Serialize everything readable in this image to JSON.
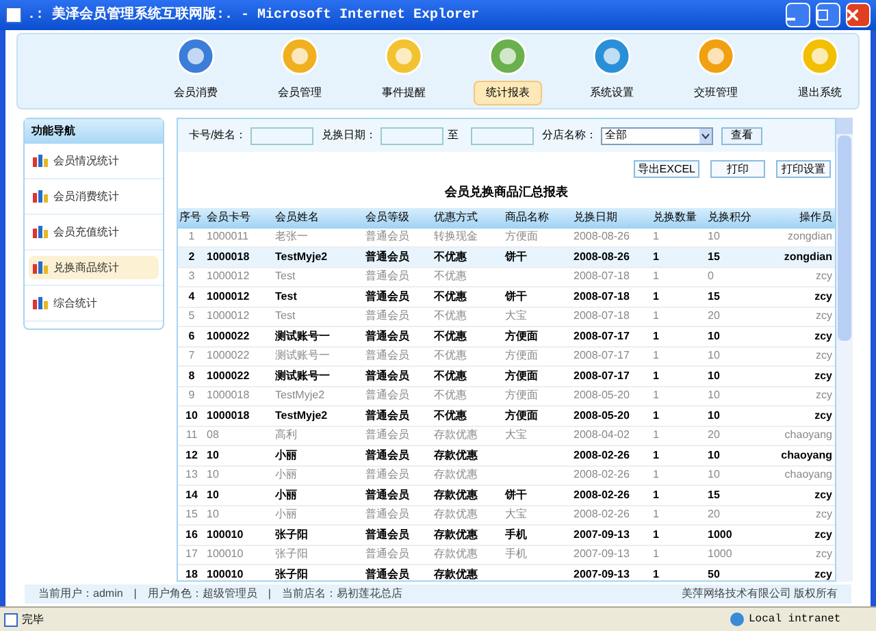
{
  "window": {
    "title": ".: 美泽会员管理系统互联网版:. - Microsoft Internet Explorer"
  },
  "nav": [
    {
      "label": "会员消费",
      "selected": false
    },
    {
      "label": "会员管理",
      "selected": false
    },
    {
      "label": "事件提醒",
      "selected": false
    },
    {
      "label": "统计报表",
      "selected": true
    },
    {
      "label": "系统设置",
      "selected": false
    },
    {
      "label": "交班管理",
      "selected": false
    },
    {
      "label": "退出系统",
      "selected": false
    }
  ],
  "sidebar": {
    "title": "功能导航",
    "items": [
      {
        "label": "会员情况统计",
        "selected": false
      },
      {
        "label": "会员消费统计",
        "selected": false
      },
      {
        "label": "会员充值统计",
        "selected": false
      },
      {
        "label": "兑换商品统计",
        "selected": true
      },
      {
        "label": "综合统计",
        "selected": false
      }
    ]
  },
  "filters": {
    "card_label": "卡号/姓名：",
    "date_label": "兑换日期：",
    "to_label": "至",
    "store_label": "分店名称：",
    "store_value": "全部",
    "search_button": "查看"
  },
  "actions": [
    "导出EXCEL",
    "打印",
    "打印设置"
  ],
  "report_title": "会员兑换商品汇总报表",
  "table": {
    "columns": [
      "序号",
      "会员卡号",
      "会员姓名",
      "会员等级",
      "优惠方式",
      "商品名称",
      "兑换日期",
      "兑换数量",
      "兑换积分",
      "操作员"
    ],
    "rows": [
      {
        "bold": false,
        "selected": false,
        "cells": [
          "1",
          "1000011",
          "老张一",
          "普通会员",
          "转换现金",
          "方便面",
          "2008-08-26",
          "1",
          "10",
          "zongdian"
        ]
      },
      {
        "bold": true,
        "selected": true,
        "cells": [
          "2",
          "1000018",
          "TestMyje2",
          "普通会员",
          "不优惠",
          "饼干",
          "2008-08-26",
          "1",
          "15",
          "zongdian"
        ]
      },
      {
        "bold": false,
        "selected": false,
        "cells": [
          "3",
          "1000012",
          "Test",
          "普通会员",
          "不优惠",
          "",
          "2008-07-18",
          "1",
          "0",
          "zcy"
        ]
      },
      {
        "bold": true,
        "selected": false,
        "cells": [
          "4",
          "1000012",
          "Test",
          "普通会员",
          "不优惠",
          "饼干",
          "2008-07-18",
          "1",
          "15",
          "zcy"
        ]
      },
      {
        "bold": false,
        "selected": false,
        "cells": [
          "5",
          "1000012",
          "Test",
          "普通会员",
          "不优惠",
          "大宝",
          "2008-07-18",
          "1",
          "20",
          "zcy"
        ]
      },
      {
        "bold": true,
        "selected": false,
        "cells": [
          "6",
          "1000022",
          "测试账号一",
          "普通会员",
          "不优惠",
          "方便面",
          "2008-07-17",
          "1",
          "10",
          "zcy"
        ]
      },
      {
        "bold": false,
        "selected": false,
        "cells": [
          "7",
          "1000022",
          "测试账号一",
          "普通会员",
          "不优惠",
          "方便面",
          "2008-07-17",
          "1",
          "10",
          "zcy"
        ]
      },
      {
        "bold": true,
        "selected": false,
        "cells": [
          "8",
          "1000022",
          "测试账号一",
          "普通会员",
          "不优惠",
          "方便面",
          "2008-07-17",
          "1",
          "10",
          "zcy"
        ]
      },
      {
        "bold": false,
        "selected": false,
        "cells": [
          "9",
          "1000018",
          "TestMyje2",
          "普通会员",
          "不优惠",
          "方便面",
          "2008-05-20",
          "1",
          "10",
          "zcy"
        ]
      },
      {
        "bold": true,
        "selected": false,
        "cells": [
          "10",
          "1000018",
          "TestMyje2",
          "普通会员",
          "不优惠",
          "方便面",
          "2008-05-20",
          "1",
          "10",
          "zcy"
        ]
      },
      {
        "bold": false,
        "selected": false,
        "cells": [
          "11",
          "08",
          "高利",
          "普通会员",
          "存款优惠",
          "大宝",
          "2008-04-02",
          "1",
          "20",
          "chaoyang"
        ]
      },
      {
        "bold": true,
        "selected": false,
        "cells": [
          "12",
          "10",
          "小丽",
          "普通会员",
          "存款优惠",
          "",
          "2008-02-26",
          "1",
          "10",
          "chaoyang"
        ]
      },
      {
        "bold": false,
        "selected": false,
        "cells": [
          "13",
          "10",
          "小丽",
          "普通会员",
          "存款优惠",
          "",
          "2008-02-26",
          "1",
          "10",
          "chaoyang"
        ]
      },
      {
        "bold": true,
        "selected": false,
        "cells": [
          "14",
          "10",
          "小丽",
          "普通会员",
          "存款优惠",
          "饼干",
          "2008-02-26",
          "1",
          "15",
          "zcy"
        ]
      },
      {
        "bold": false,
        "selected": false,
        "cells": [
          "15",
          "10",
          "小丽",
          "普通会员",
          "存款优惠",
          "大宝",
          "2008-02-26",
          "1",
          "20",
          "zcy"
        ]
      },
      {
        "bold": true,
        "selected": false,
        "cells": [
          "16",
          "100010",
          "张子阳",
          "普通会员",
          "存款优惠",
          "手机",
          "2007-09-13",
          "1",
          "1000",
          "zcy"
        ]
      },
      {
        "bold": false,
        "selected": false,
        "cells": [
          "17",
          "100010",
          "张子阳",
          "普通会员",
          "存款优惠",
          "手机",
          "2007-09-13",
          "1",
          "1000",
          "zcy"
        ]
      },
      {
        "bold": true,
        "selected": false,
        "cells": [
          "18",
          "100010",
          "张子阳",
          "普通会员",
          "存款优惠",
          "",
          "2007-09-13",
          "1",
          "50",
          "zcy"
        ]
      }
    ]
  },
  "footer": {
    "separators": [
      "|",
      "|"
    ],
    "user": "当前用户：admin",
    "role": "用户角色：超级管理员",
    "store": "当前店名：易初莲花总店",
    "copyright": "美萍网络技术有限公司 版权所有"
  },
  "status_bar": {
    "text": "完毕",
    "zone": "Local intranet"
  }
}
